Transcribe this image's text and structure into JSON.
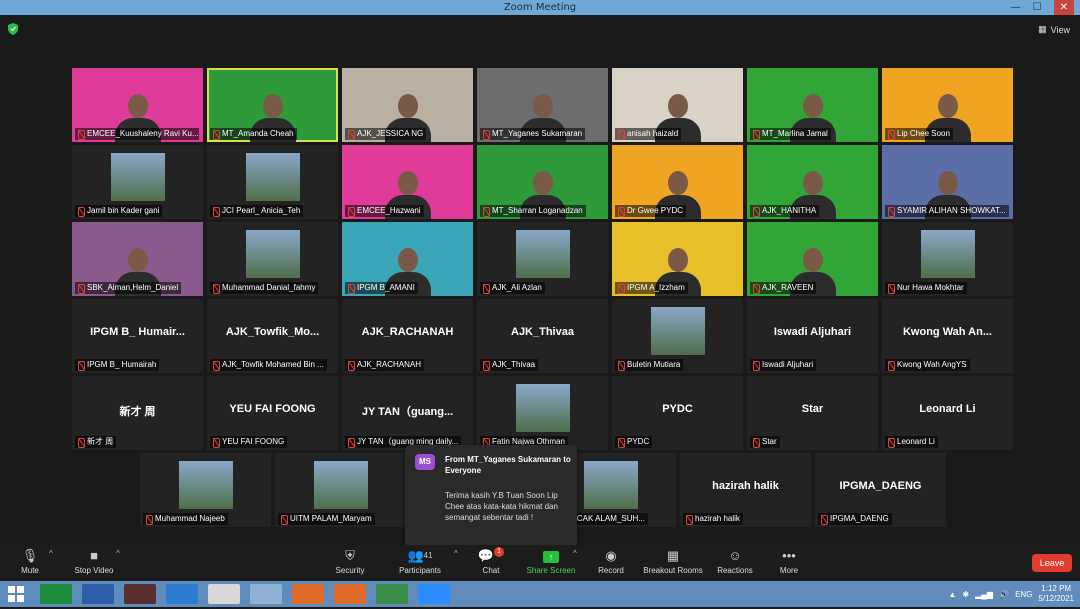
{
  "window": {
    "title": "Zoom Meeting",
    "controls": [
      "—",
      "☐",
      "✕"
    ]
  },
  "view_label": "View",
  "tiles": [
    {
      "name": "EMCEE_Kuushaleny Ravi Ku...",
      "kind": "video",
      "bg": "#e03b98",
      "active": false
    },
    {
      "name": "MT_Amanda Cheah",
      "kind": "video",
      "bg": "#2f9a3a",
      "active": true
    },
    {
      "name": "AJK_JESSICA NG",
      "kind": "video",
      "bg": "#b9b0a3",
      "active": false
    },
    {
      "name": "MT_Yaganes Sukamaran",
      "kind": "video",
      "bg": "#6b6d6f",
      "active": false
    },
    {
      "name": "anisah haizald",
      "kind": "video",
      "bg": "#d9d2c6",
      "active": false
    },
    {
      "name": "MT_Marlina Jamal",
      "kind": "video",
      "bg": "#31a535",
      "active": false
    },
    {
      "name": "Lip Chee Soon",
      "kind": "video",
      "bg": "#f0a522",
      "active": false
    },
    {
      "name": "Jamil bin Kader gani",
      "kind": "photo",
      "bg": "#2a2a2a",
      "active": false
    },
    {
      "name": "JCI Pearl_ Anicia_Teh",
      "kind": "photo",
      "bg": "#2a2a2a",
      "active": false
    },
    {
      "name": "EMCEE_Hazwani",
      "kind": "video",
      "bg": "#e03b98",
      "active": false
    },
    {
      "name": "MT_Sharran Loganadzan",
      "kind": "video",
      "bg": "#2f9a3a",
      "active": false
    },
    {
      "name": "Dr Gwee PYDC",
      "kind": "video",
      "bg": "#f0a522",
      "active": false
    },
    {
      "name": "AJK_HANITHA",
      "kind": "video",
      "bg": "#31a535",
      "active": false
    },
    {
      "name": "SYAMIR ALIHAN SHOWKAT...",
      "kind": "video",
      "bg": "#5b6ea8",
      "active": false
    },
    {
      "name": "SBK_Aiman,Helm_Daniel",
      "kind": "video",
      "bg": "#8a5a8e",
      "active": false
    },
    {
      "name": "Muhammad Danial_fahmy",
      "kind": "photo",
      "bg": "#2a2a2a",
      "active": false
    },
    {
      "name": "IPGM B_AMANI",
      "kind": "video",
      "bg": "#3aa7b8",
      "active": false
    },
    {
      "name": "AJK_Ali Azlan",
      "kind": "photo",
      "bg": "#2a2a2a",
      "active": false
    },
    {
      "name": "IPGM A_Izzham",
      "kind": "video",
      "bg": "#e8c02a",
      "active": false
    },
    {
      "name": "AJK_RAVEEN",
      "kind": "video",
      "bg": "#31a535",
      "active": false
    },
    {
      "name": "Nur Hawa Mokhtar",
      "kind": "photo",
      "bg": "#2a2a2a",
      "active": false
    },
    {
      "name": "IPGM B_ Humairah",
      "kind": "text",
      "label": "IPGM B_ Humair...",
      "active": false
    },
    {
      "name": "AJK_Towfik Mohamed Bin ...",
      "kind": "text",
      "label": "AJK_Towfik_Mo...",
      "active": false
    },
    {
      "name": "AJK_RACHANAH",
      "kind": "text",
      "label": "AJK_RACHANAH",
      "active": false
    },
    {
      "name": "AJK_Thivaa",
      "kind": "text",
      "label": "AJK_Thivaa",
      "active": false
    },
    {
      "name": "Buletin Mutiara",
      "kind": "photo",
      "bg": "#2a2a2a",
      "active": false
    },
    {
      "name": "Iswadi Aljuhari",
      "kind": "text",
      "label": "Iswadi Aljuhari",
      "active": false
    },
    {
      "name": "Kwong Wah AngYS",
      "kind": "text",
      "label": "Kwong Wah An...",
      "active": false
    },
    {
      "name": "新才 周",
      "kind": "text",
      "label": "新才 周",
      "active": false
    },
    {
      "name": "YEU FAI FOONG",
      "kind": "text",
      "label": "YEU FAI FOONG",
      "active": false
    },
    {
      "name": "JY TAN（guang ming daily...",
      "kind": "text",
      "label": "JY TAN（guang...",
      "active": false
    },
    {
      "name": "Fatin Najwa Othman",
      "kind": "photo",
      "bg": "#2a2a2a",
      "active": false
    },
    {
      "name": "PYDC",
      "kind": "text",
      "label": "PYDC",
      "active": false
    },
    {
      "name": "Star",
      "kind": "text",
      "label": "Star",
      "active": false
    },
    {
      "name": "Leonard Li",
      "kind": "text",
      "label": "Leonard Li",
      "active": false
    }
  ],
  "bottom_row": [
    {
      "name": "Muhammad Najeeb",
      "kind": "photo",
      "label": ""
    },
    {
      "name": "UITM PALAM_Maryam",
      "kind": "photo",
      "label": ""
    },
    {
      "name": "PUNCAK ALAM_SUH...",
      "kind": "photo",
      "label": ""
    },
    {
      "name": "hazirah halik",
      "kind": "text",
      "label": "hazirah halik"
    },
    {
      "name": "IPGMA_DAENG",
      "kind": "text",
      "label": "IPGMA_DAENG"
    }
  ],
  "chat_popup": {
    "avatar": "MS",
    "from": "From MT_Yaganes Sukamaran to Everyone",
    "message": "Terima kasih Y.B Tuan Soon Lip Chee atas kata-kata hikmat dan semangat sebentar tadi !"
  },
  "toolbar": {
    "mute": "Mute",
    "stop_video": "Stop Video",
    "security": "Security",
    "participants": "Participants",
    "participants_count": "41",
    "chat": "Chat",
    "chat_badge": "1",
    "share_screen": "Share Screen",
    "record": "Record",
    "breakout": "Breakout Rooms",
    "reactions": "Reactions",
    "more": "More",
    "leave": "Leave"
  },
  "taskbar": {
    "lang": "ENG",
    "time": "1:12 PM",
    "date": "5/12/2021"
  },
  "colors": {
    "accent_green": "#23c03b",
    "leave_red": "#e23c31",
    "active_outline": "#d7e049"
  }
}
